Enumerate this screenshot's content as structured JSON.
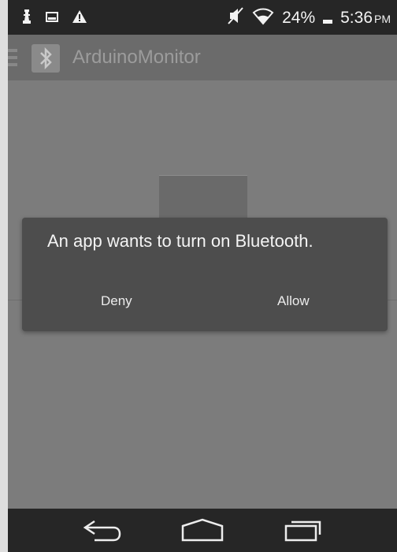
{
  "status_bar": {
    "battery_percent": "24%",
    "time": "5:36",
    "ampm": "PM",
    "icons": [
      "chess-piece-icon",
      "image-notification-icon",
      "warning-icon",
      "mute-icon",
      "wifi-icon",
      "battery-icon"
    ]
  },
  "action_bar": {
    "app_icon": "bluetooth-icon",
    "title": "ArduinoMonitor"
  },
  "dialog": {
    "message": "An app wants to turn on Bluetooth.",
    "deny_label": "Deny",
    "allow_label": "Allow"
  },
  "nav_bar": {
    "icons": [
      "back-icon",
      "home-icon",
      "recents-icon"
    ]
  }
}
